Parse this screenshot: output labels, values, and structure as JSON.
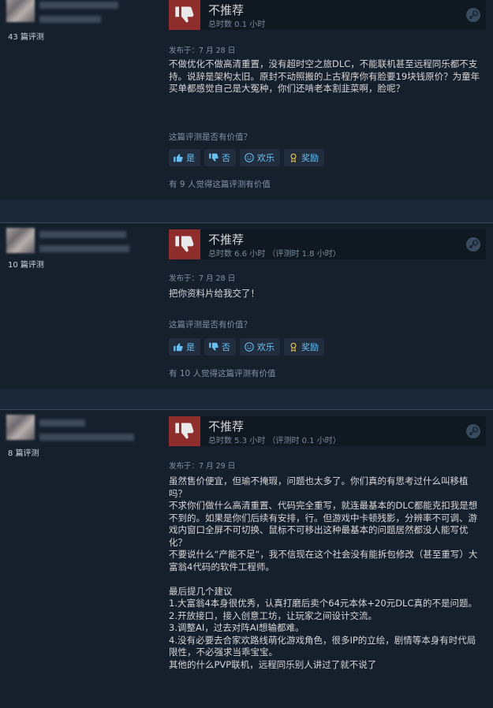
{
  "reviews": [
    {
      "reviewer_reviews": "43 篇评测",
      "verdict": "不推荐",
      "hours": "总时数 0.1 小时",
      "posted": "发布于：7 月 28 日",
      "content": "不做优化不做高清重置，没有超时空之旅DLC，不能联机甚至远程同乐都不支持。说辞是架构太旧。原封不动照搬的上古程序你有脸要19块钱原价？为童年买单都感觉自己是大冤种，你们还啃老本割韭菜啊，脸呢？",
      "helpful_question": "这篇评测是否有价值？",
      "buttons": {
        "yes": "是",
        "no": "否",
        "funny": "欢乐",
        "award": "奖励"
      },
      "found_helpful": "有 9 人觉得这篇评测有价值"
    },
    {
      "reviewer_reviews": "10 篇评测",
      "verdict": "不推荐",
      "hours": "总时数 6.6 小时 （评测时 1.8 小时）",
      "posted": "发布于：7 月 28 日",
      "content": "把你资料片给我交了！",
      "helpful_question": "这篇评测是否有价值？",
      "buttons": {
        "yes": "是",
        "no": "否",
        "funny": "欢乐",
        "award": "奖励"
      },
      "found_helpful": "有 10 人觉得这篇评测有价值"
    },
    {
      "reviewer_reviews": "8 篇评测",
      "verdict": "不推荐",
      "hours": "总时数 5.3 小时 （评测时 0.1 小时）",
      "posted": "发布于：7 月 29 日",
      "content_lines": [
        "虽然售价便宜，但瑜不掩瑕，问题也太多了。你们真的有思考过什么叫移植吗？",
        "不求你们做什么高清重置、代码完全重写，就连最基本的DLC都能克扣我是想不到的。如果是你们后续有安排，行。但游戏中卡顿残影，分辨率不可调、游戏内窗口全屏不可切换、鼠标不可移出这种最基本的问题居然都没人能写优化？",
        "不要说什么“产能不足“，我不信现在这个社会没有能拆包修改（甚至重写）大富翁4代码的软件工程师。",
        "",
        "最后提几个建议",
        "1.大富翁4本身很优秀，认真打磨后卖个64元本体+20元DLC真的不是问题。",
        "2.开放接口，接入创意工坊，让玩家之间设计交流。",
        "3.调整AI，过去对阵AI想输都难。",
        "4.没有必要去合家欢路线萌化游戏角色，很多IP的立绘，剧情等本身有时代局限性，不必强求当乖宝宝。",
        "其他的什么PVP联机，远程同乐别人讲过了就不说了"
      ]
    }
  ],
  "colors": {
    "thumb_down_bg": "#8f2c2c",
    "link_blue": "#66c0f4",
    "text": "#d6d7d8",
    "muted": "#8091a2"
  },
  "icons": [
    "thumb-down-icon",
    "steam-logo-icon",
    "thumb-up-icon",
    "smile-icon",
    "award-icon"
  ]
}
